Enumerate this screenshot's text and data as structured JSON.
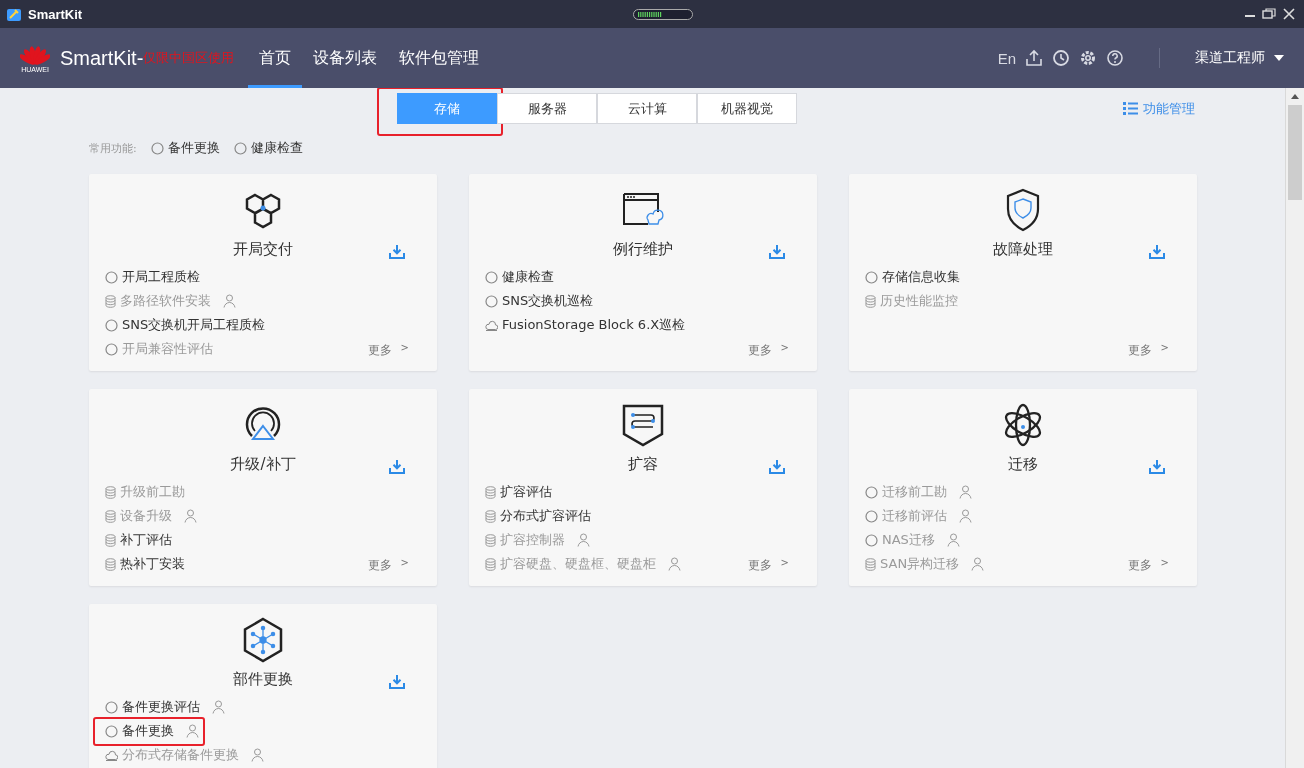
{
  "window": {
    "title": "SmartKit"
  },
  "header": {
    "brand": "SmartKit-",
    "brand_note": "仅限中国区使用",
    "logo_text": "HUAWEI",
    "nav": [
      {
        "label": "首页",
        "selected": true
      },
      {
        "label": "设备列表",
        "selected": false
      },
      {
        "label": "软件包管理",
        "selected": false
      }
    ],
    "language": "En",
    "user": "渠道工程师"
  },
  "category_tabs": [
    {
      "label": "存储",
      "selected": true,
      "highlighted": true
    },
    {
      "label": "服务器",
      "selected": false,
      "highlighted": false
    },
    {
      "label": "云计算",
      "selected": false,
      "highlighted": false
    },
    {
      "label": "机器视觉",
      "selected": false,
      "highlighted": false
    }
  ],
  "manage_link": "功能管理",
  "common": {
    "label": "常用功能:",
    "items": [
      "备件更换",
      "健康检查"
    ]
  },
  "cards": [
    {
      "title": "开局交付",
      "more": "更多",
      "more_arrow": ">",
      "items": [
        {
          "label": "开局工程质检",
          "kind": "circle",
          "disabled": false,
          "user": false,
          "highlighted": false
        },
        {
          "label": "多路径软件安装",
          "kind": "db",
          "disabled": true,
          "user": true,
          "highlighted": false
        },
        {
          "label": "SNS交换机开局工程质检",
          "kind": "circle",
          "disabled": false,
          "user": false,
          "highlighted": false
        },
        {
          "label": "开局兼容性评估",
          "kind": "circle",
          "disabled": true,
          "user": false,
          "highlighted": false
        }
      ]
    },
    {
      "title": "例行维护",
      "more": "更多",
      "more_arrow": ">",
      "items": [
        {
          "label": "健康检查",
          "kind": "circle",
          "disabled": false,
          "user": false,
          "highlighted": false
        },
        {
          "label": "SNS交换机巡检",
          "kind": "circle",
          "disabled": false,
          "user": false,
          "highlighted": false
        },
        {
          "label": "FusionStorage Block 6.X巡检",
          "kind": "cloud",
          "disabled": false,
          "user": false,
          "highlighted": false
        }
      ]
    },
    {
      "title": "故障处理",
      "more": "更多",
      "more_arrow": ">",
      "items": [
        {
          "label": "存储信息收集",
          "kind": "circle",
          "disabled": false,
          "user": false,
          "highlighted": false
        },
        {
          "label": "历史性能监控",
          "kind": "db",
          "disabled": true,
          "user": false,
          "highlighted": false
        }
      ]
    },
    {
      "title": "升级/补丁",
      "more": "更多",
      "more_arrow": ">",
      "items": [
        {
          "label": "升级前工勘",
          "kind": "db",
          "disabled": true,
          "user": false,
          "highlighted": false
        },
        {
          "label": "设备升级",
          "kind": "db",
          "disabled": true,
          "user": true,
          "highlighted": false
        },
        {
          "label": "补丁评估",
          "kind": "db",
          "disabled": false,
          "user": false,
          "highlighted": false
        },
        {
          "label": "热补丁安装",
          "kind": "db",
          "disabled": false,
          "user": false,
          "highlighted": false
        }
      ]
    },
    {
      "title": "扩容",
      "more": "更多",
      "more_arrow": ">",
      "items": [
        {
          "label": "扩容评估",
          "kind": "db",
          "disabled": false,
          "user": false,
          "highlighted": false
        },
        {
          "label": "分布式扩容评估",
          "kind": "db",
          "disabled": false,
          "user": false,
          "highlighted": false
        },
        {
          "label": "扩容控制器",
          "kind": "db",
          "disabled": true,
          "user": true,
          "highlighted": false
        },
        {
          "label": "扩容硬盘、硬盘框、硬盘柜",
          "kind": "db",
          "disabled": true,
          "user": true,
          "highlighted": false
        }
      ]
    },
    {
      "title": "迁移",
      "more": "更多",
      "more_arrow": ">",
      "items": [
        {
          "label": "迁移前工勘",
          "kind": "circle",
          "disabled": true,
          "user": true,
          "highlighted": false
        },
        {
          "label": "迁移前评估",
          "kind": "circle",
          "disabled": true,
          "user": true,
          "highlighted": false
        },
        {
          "label": "NAS迁移",
          "kind": "circle",
          "disabled": true,
          "user": true,
          "highlighted": false
        },
        {
          "label": "SAN异构迁移",
          "kind": "db",
          "disabled": true,
          "user": true,
          "highlighted": false
        }
      ]
    },
    {
      "title": "部件更换",
      "items": [
        {
          "label": "备件更换评估",
          "kind": "circle",
          "disabled": false,
          "user": true,
          "highlighted": false
        },
        {
          "label": "备件更换",
          "kind": "circle",
          "disabled": false,
          "user": true,
          "highlighted": true
        },
        {
          "label": "分布式存储备件更换",
          "kind": "cloud",
          "disabled": true,
          "user": true,
          "highlighted": false
        }
      ]
    }
  ]
}
